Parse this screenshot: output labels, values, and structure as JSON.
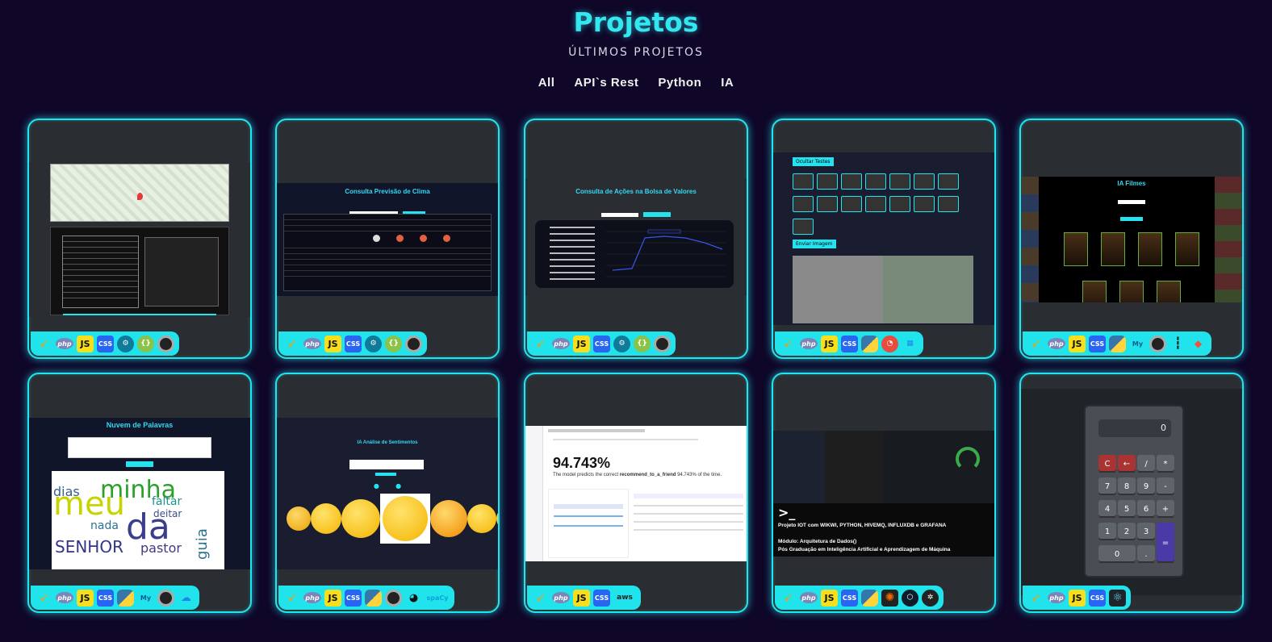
{
  "header": {
    "title": "Projetos",
    "subtitle": "ÚLTIMOS PROJETOS"
  },
  "filters": [
    {
      "label": "All"
    },
    {
      "label": "API`s Rest"
    },
    {
      "label": "Python"
    },
    {
      "label": "IA"
    }
  ],
  "cards": [
    {
      "name": "project-card-cep-map",
      "techs": [
        "bird-icon",
        "php-icon",
        "js-icon",
        "css3-icon",
        "gear-icon",
        "graphql-icon",
        "ring-icon"
      ]
    },
    {
      "name": "project-card-weather",
      "title": "Consulta Previsão de Clima",
      "techs": [
        "bird-icon",
        "php-icon",
        "js-icon",
        "css3-icon",
        "gear-icon",
        "graphql-icon",
        "ring-icon"
      ]
    },
    {
      "name": "project-card-stocks",
      "title": "Consulta de Ações na Bolsa de Valores",
      "techs": [
        "bird-icon",
        "php-icon",
        "js-icon",
        "css3-icon",
        "gear-icon",
        "graphql-icon",
        "ring-icon"
      ]
    },
    {
      "name": "project-card-count-objects",
      "btn1": "Ocultar Testes",
      "btn2": "Enviar Imagem",
      "techs": [
        "bird-icon",
        "php-icon",
        "js-icon",
        "css3-icon",
        "python-icon",
        "opencv-icon",
        "cube-icon"
      ]
    },
    {
      "name": "project-card-ia-filmes",
      "title": "IA Filmes",
      "techs": [
        "bird-icon",
        "php-icon",
        "js-icon",
        "css3-icon",
        "python-icon",
        "mysql-icon",
        "ring-icon",
        "bars-icon",
        "swift-icon"
      ]
    },
    {
      "name": "project-card-word-cloud",
      "title": "Nuvem de Palavras",
      "words": [
        "minha",
        "meu",
        "da",
        "dias",
        "faltar",
        "nada",
        "SENHOR",
        "pastor",
        "guia",
        "deitar"
      ],
      "techs": [
        "bird-icon",
        "php-icon",
        "js-icon",
        "css3-icon",
        "python-icon",
        "mysql-icon",
        "ring-icon",
        "cloud-icon"
      ]
    },
    {
      "name": "project-card-sentiment",
      "title": "IA Análise de Sentimentos",
      "techs": [
        "bird-icon",
        "php-icon",
        "js-icon",
        "css3-icon",
        "python-icon",
        "ring-icon",
        "jupyter-icon",
        "spacy-icon"
      ]
    },
    {
      "name": "project-card-model-accuracy",
      "metric": "94.743%",
      "desc": "The model predicts the correct",
      "bold": "recommend_to_a_friend",
      "tail": "94.743% of the time.",
      "techs": [
        "bird-icon",
        "php-icon",
        "js-icon",
        "css3-icon",
        "aws-icon"
      ]
    },
    {
      "name": "project-card-iot",
      "line1": "Projeto IOT com WIKWI, PYTHON, HIVEMQ, INFLUXDB e GRAFANA",
      "line2": "Módulo: Arquitetura de Dados()",
      "line3": "Pós Graduação em Inteligência Artificial  e Aprendizagem de Máquina",
      "techs": [
        "bird-icon",
        "php-icon",
        "js-icon",
        "css3-icon",
        "python-icon",
        "grafana-icon",
        "influx-icon",
        "hivemq-icon"
      ]
    },
    {
      "name": "project-card-calculator",
      "display": "0",
      "keys": [
        "C",
        "←",
        "/",
        "*",
        "7",
        "8",
        "9",
        "-",
        "4",
        "5",
        "6",
        "+",
        "1",
        "2",
        "3",
        "=",
        "0",
        "."
      ],
      "techs": [
        "bird-icon",
        "php-icon",
        "js-icon",
        "css3-icon",
        "react-icon"
      ]
    }
  ],
  "accent": "#22e4ee",
  "background": "#0f0628"
}
